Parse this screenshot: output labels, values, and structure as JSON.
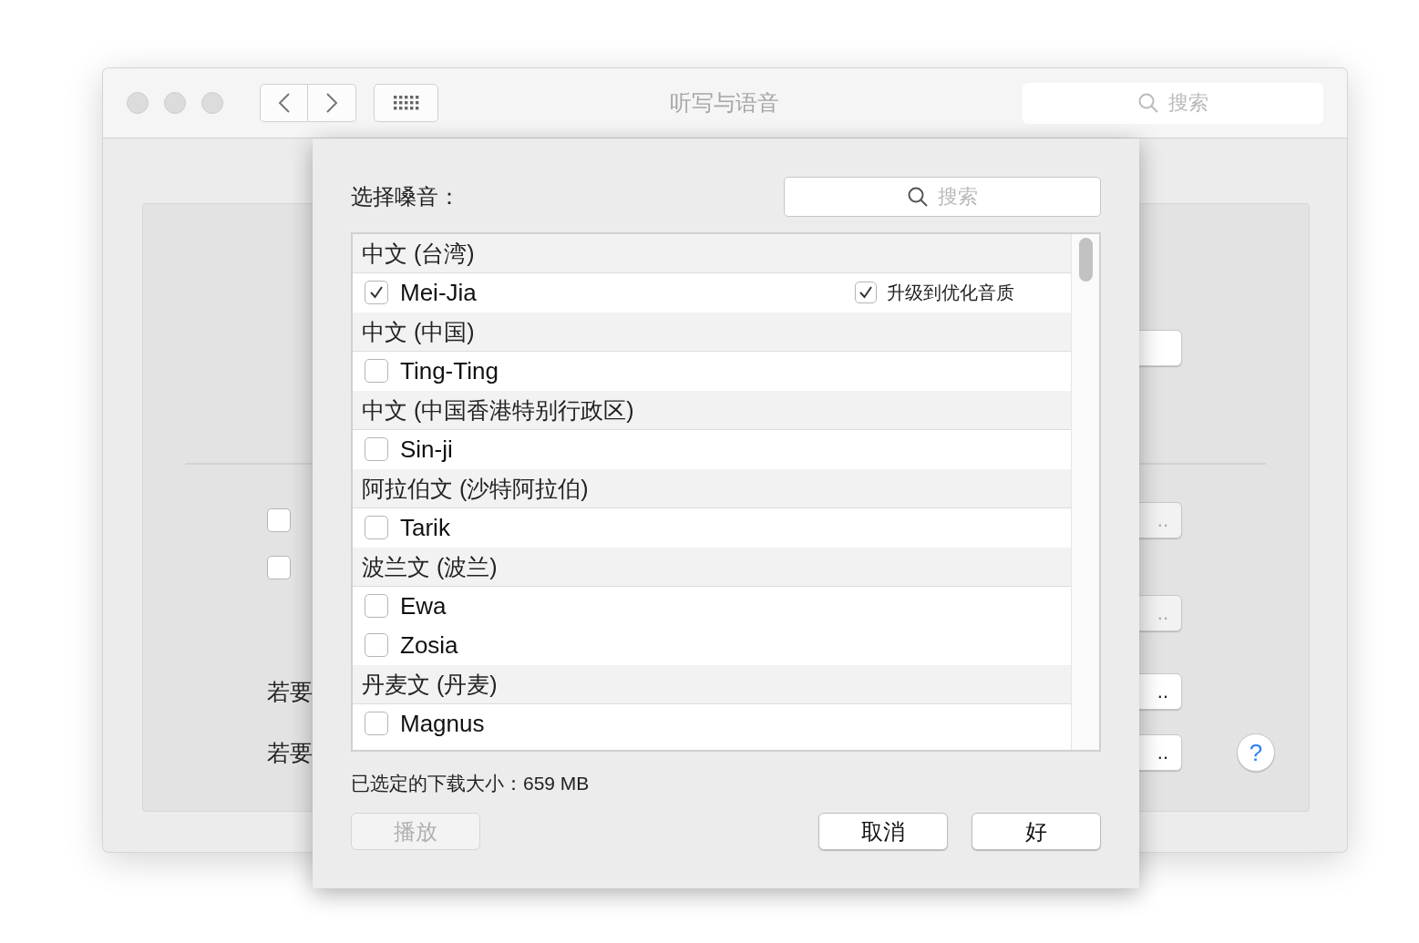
{
  "window": {
    "title": "听写与语音",
    "search": {
      "placeholder": "搜索"
    }
  },
  "background": {
    "checkboxes": [
      {
        "checked": false
      },
      {
        "checked": false
      }
    ],
    "notes": [
      "若要",
      "若要"
    ],
    "buttons": [
      {
        "kind": "plain",
        "disabled": false
      },
      {
        "kind": "more",
        "label": "..",
        "disabled": true
      },
      {
        "kind": "more",
        "label": "..",
        "disabled": true
      },
      {
        "kind": "more",
        "label": "..",
        "disabled": false
      },
      {
        "kind": "more",
        "label": "..",
        "disabled": false
      }
    ],
    "help": "?"
  },
  "sheet": {
    "prompt": "选择嗓音：",
    "search": {
      "placeholder": "搜索"
    },
    "voices": [
      {
        "kind": "section",
        "label": "中文 (台湾)"
      },
      {
        "kind": "voice",
        "label": "Mei-Jia",
        "checked": true,
        "upgrade": {
          "label": "升级到优化音质",
          "checked": true
        }
      },
      {
        "kind": "section",
        "label": "中文 (中国)"
      },
      {
        "kind": "voice",
        "label": "Ting-Ting",
        "checked": false
      },
      {
        "kind": "section",
        "label": "中文 (中国香港特别行政区)"
      },
      {
        "kind": "voice",
        "label": "Sin-ji",
        "checked": false
      },
      {
        "kind": "section",
        "label": "阿拉伯文 (沙特阿拉伯)"
      },
      {
        "kind": "voice",
        "label": "Tarik",
        "checked": false
      },
      {
        "kind": "section",
        "label": "波兰文 (波兰)"
      },
      {
        "kind": "voice",
        "label": "Ewa",
        "checked": false
      },
      {
        "kind": "voice",
        "label": "Zosia",
        "checked": false
      },
      {
        "kind": "section",
        "label": "丹麦文 (丹麦)"
      },
      {
        "kind": "voice",
        "label": "Magnus",
        "checked": false
      }
    ],
    "download_size": "已选定的下载大小：659 MB",
    "buttons": [
      {
        "label": "播放",
        "disabled": true
      },
      {
        "label": "取消",
        "disabled": false
      },
      {
        "label": "好",
        "disabled": false
      }
    ]
  }
}
